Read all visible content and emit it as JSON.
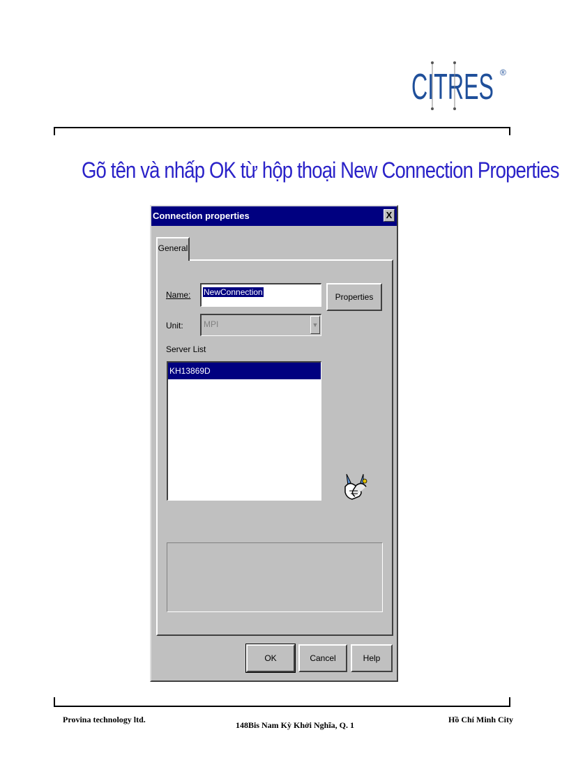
{
  "logo": {
    "text": "CITRES",
    "mark": "®",
    "color": "#1f4f9a"
  },
  "slide": {
    "title": "Gõ tên và nhấp OK từ hộp thoại New Connection Properties",
    "title_color": "#2a22c8"
  },
  "dialog": {
    "title": "Connection properties",
    "close_label": "X",
    "tab_label": "General",
    "name_label": "Name:",
    "name_value": "NewConnection",
    "properties_label": "Properties",
    "unit_label": "Unit:",
    "unit_value": "MPI",
    "server_list_label": "Server List",
    "server_items": [
      "KH13869D"
    ],
    "ok_label": "OK",
    "cancel_label": "Cancel",
    "help_label": "Help",
    "icon": "handshake-icon"
  },
  "footer": {
    "left": "Provina technology ltd.",
    "middle": "148Bis Nam Kỳ Khởi Nghĩa, Q. 1",
    "right": "Hồ Chí Minh City"
  }
}
